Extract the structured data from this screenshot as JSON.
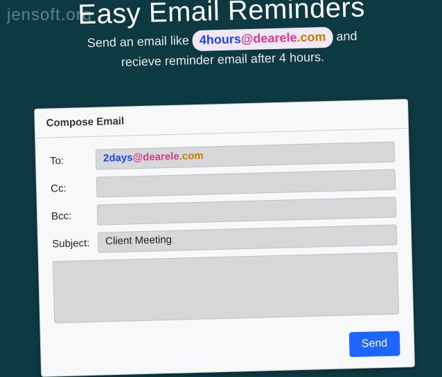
{
  "watermark": "jensoft.org",
  "hero": {
    "title": "Easy Email Reminders",
    "sub_prefix": "Send an email like ",
    "pill_time": "4hours",
    "pill_at": "@dearele",
    "pill_tld": ".com",
    "sub_mid": " and",
    "sub_line2": "recieve reminder email after 4 hours."
  },
  "compose": {
    "header": "Compose Email",
    "labels": {
      "to": "To:",
      "cc": "Cc:",
      "bcc": "Bcc:",
      "subject": "Subject:"
    },
    "to_time": "2days",
    "to_at": "@dearele",
    "to_tld": ".com",
    "cc_value": "",
    "bcc_value": "",
    "subject_value": "Client Meeting",
    "body_value": "",
    "send_label": "Send"
  }
}
